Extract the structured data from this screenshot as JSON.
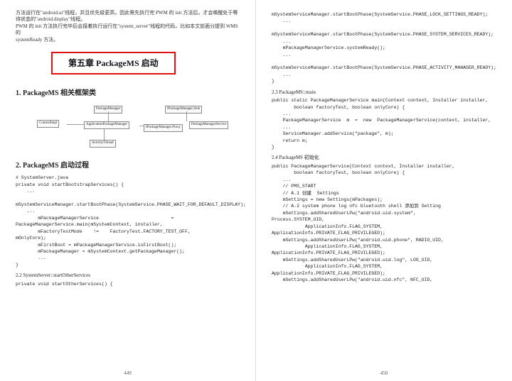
{
  "left": {
    "intro_lines": [
      "方法运行在\"android.ui\"线程，并且优先级更高，因此需先执行完 PWM 的 init 方法后，才会唤醒处于等待状态的\"android.display\"线程。",
      "PWM 的 init 方法执行完毕后会接着执行运行在\"system_server\"线程的代码，比如本文前面分提到 WMS 的",
      "systemReady 方法。"
    ],
    "chapter": "第五章  PackageMS 启动",
    "sec1": "1.  PackageMS 相关框架类",
    "diagram": {
      "b1": "ContextImpl",
      "b2": "PackageManager",
      "b3": "IPackageManager.Stub",
      "b4": "ApplicationPackageManager",
      "b5": "IPackageManager.Proxy",
      "b6": "PackageManagerService",
      "b7": "ActivityThread"
    },
    "sec2": "2. PackageMS  启动过程",
    "code1": "# SystemServer.java\nprivate void startBootstrapServices() {\n    ...\n\nmSystemServiceManager.startBootPhase(SystemService.PHASE_WAIT_FOR_DEFAULT_DISPLAY);\n    ...\n        mPackageManagerService                          =\nPackageManagerService.main(mSystemContext, installer,\n        mFactoryTestMode    !=    FactoryTest.FACTORY_TEST_OFF,\nmOnlyCore);\n        mFirstBoot = mPackageManagerService.isFirstBoot();\n        mPackageManager = mSystemContext.getPackageManager();\n        ...\n}\n",
    "sub22": "2.2 SystemServer::startOtherServices",
    "code2": "private void startOtherServices() {",
    "pgnum": "449"
  },
  "right": {
    "code_top": "mSystemServiceManager.startBootPhase(SystemService.PHASE_LOCK_SETTINGS_READY);\n    ...\n\nmSystemServiceManager.startBootPhase(SystemService.PHASE_SYSTEM_SERVICES_READY);\n    ...\n    mPackageManagerService.systemReady();\n    ...\n\nmSystemServiceManager.startBootPhase(SystemService.PHASE_ACTIVITY_MANAGER_READY);\n    ...\n}\n",
    "sub23": "2.3 PackageMS::main",
    "code23": "public static PackageManagerService main(Context context, Installer installer,\n        boolean factoryTest, boolean onlyCore) {\n    ...\n    PackageManagerService  m  =  new  PackageManagerService(context, installer,\n    ...\n    ServiceManager.addService(\"package\", m);\n    return m;\n}\n",
    "sub24": "2.4 PackageMS 初始化",
    "code24": "public PackageManagerService(Context context, Installer installer,\n        boolean factoryTest, boolean onlyCore) {\n    ...\n    // PMS_START\n    // A.1 创建  Settings\n    mSettings = new Settings(mPackages);\n    // A.2 system phone log nfc bluetooth shell 添加到 Setting\n    mSettings.addSharedUserLPw(\"android.uid.system\",\nProcess.SYSTEM_UID,\n            ApplicationInfo.FLAG_SYSTEM,\nApplicationInfo.PRIVATE_FLAG_PRIVILEGED);\n    mSettings.addSharedUserLPw(\"android.uid.phone\", RADIO_UID,\n            ApplicationInfo.FLAG_SYSTEM,\nApplicationInfo.PRIVATE_FLAG_PRIVILEGED);\n    mSettings.addSharedUserLPw(\"android.uid.log\", LOG_UID,\n            ApplicationInfo.FLAG_SYSTEM,\nApplicationInfo.PRIVATE_FLAG_PRIVILEGED);\n    mSettings.addSharedUserLPw(\"android.uid.nfc\", NFC_UID,",
    "pgnum": "450"
  }
}
